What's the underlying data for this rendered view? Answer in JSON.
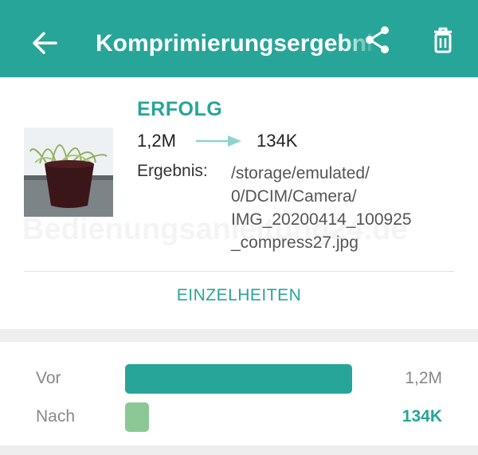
{
  "appbar": {
    "title": "Komprimierungsergebnis",
    "back_icon": "arrow-left-icon",
    "share_icon": "share-icon",
    "delete_icon": "trash-icon"
  },
  "result": {
    "status": "ERFOLG",
    "size_before": "1,2M",
    "size_after": "134K",
    "result_label": "Ergebnis:",
    "path_lines": [
      "/storage/emulated/",
      "0/DCIM/Camera/",
      "IMG_20200414_100925",
      "_compress27.jpg"
    ],
    "details_button": "EINZELHEITEN"
  },
  "watermark": "Bedienungsanleitung24.de",
  "comparison": {
    "before": {
      "label": "Vor",
      "value": "1,2M",
      "fraction": 1.0
    },
    "after": {
      "label": "Nach",
      "value": "134K",
      "fraction": 0.105
    }
  },
  "colors": {
    "primary": "#27a598",
    "before_bar": "#27a598",
    "after_bar": "#8cc896",
    "arrow": "#8fd3cd"
  }
}
